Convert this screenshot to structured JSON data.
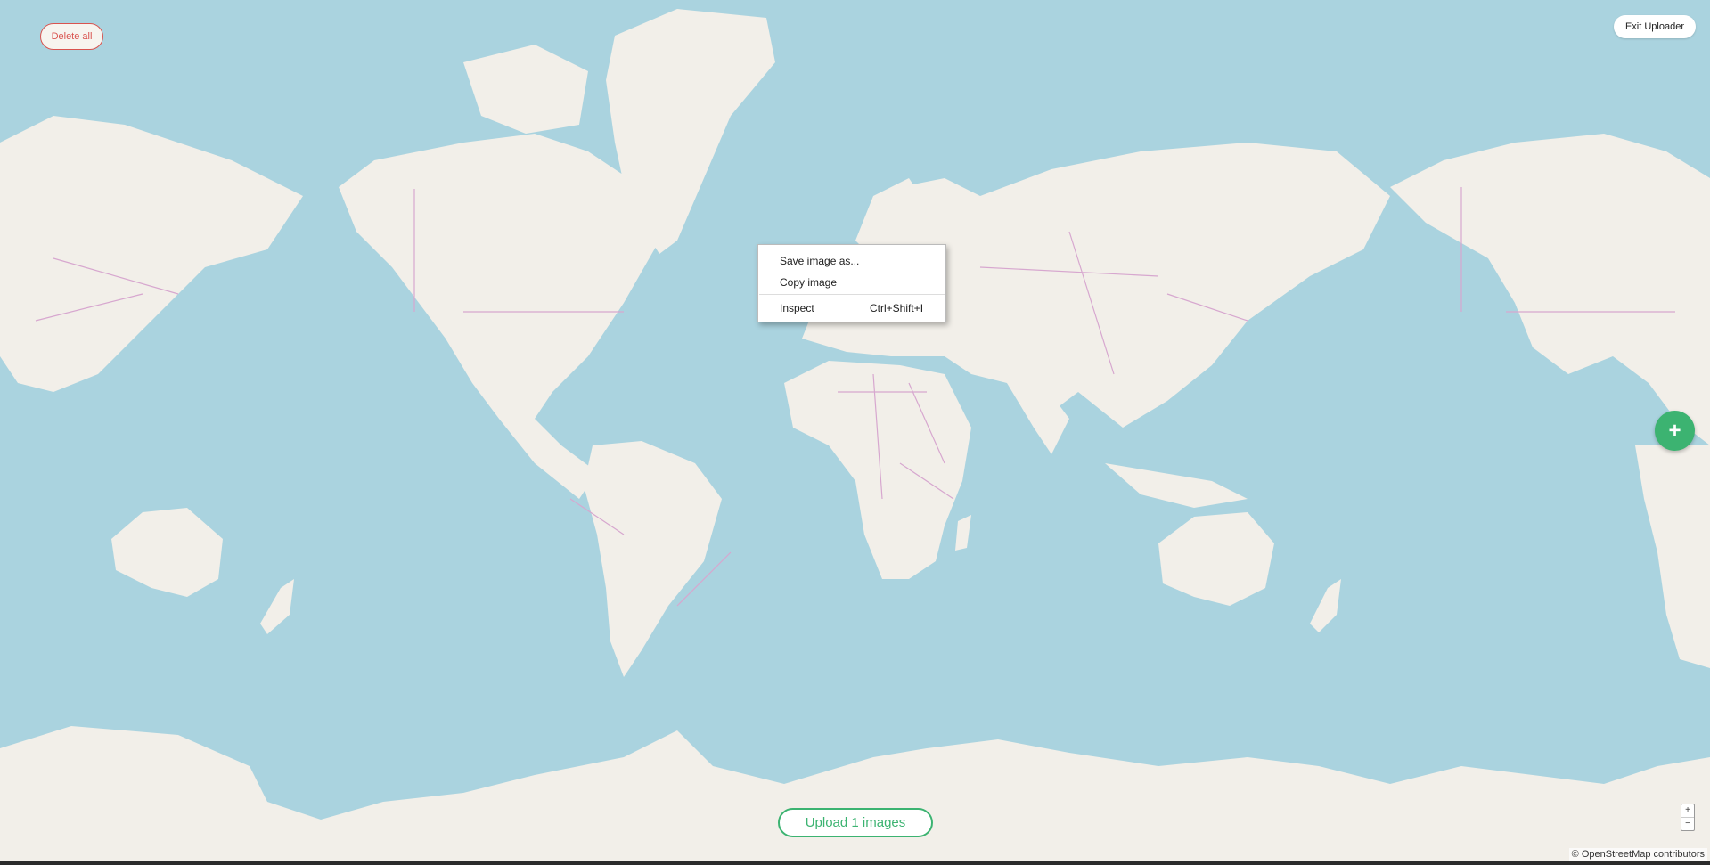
{
  "toolbar": {
    "delete_all_label": "Delete all",
    "exit_label": "Exit Uploader",
    "add_icon": "plus-icon",
    "add_symbol": "+"
  },
  "upload": {
    "label": "Upload 1 images"
  },
  "zoom": {
    "in": "+",
    "out": "−"
  },
  "attribution": "© OpenStreetMap contributors",
  "context_menu": {
    "items": [
      {
        "label": "Save image as...",
        "shortcut": ""
      },
      {
        "label": "Copy image",
        "shortcut": ""
      },
      {
        "label": "Inspect",
        "shortcut": "Ctrl+Shift+I"
      }
    ]
  },
  "colors": {
    "water": "#aad3df",
    "land": "#f2efe9",
    "border": "#d7a7cf",
    "accent_green": "#3cb371",
    "danger_red": "#d9534f"
  }
}
